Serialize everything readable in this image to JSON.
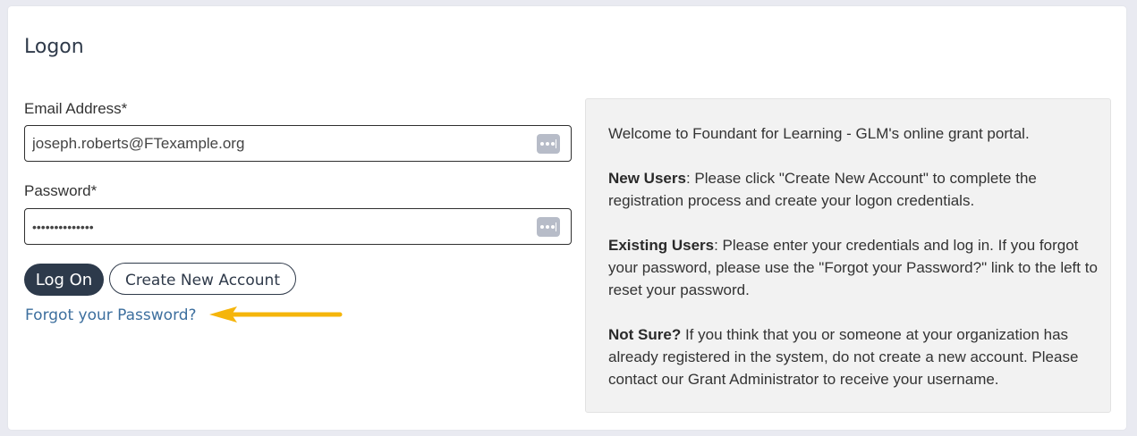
{
  "logon": {
    "title": "Logon",
    "email_label": "Email Address*",
    "email_value": "joseph.roberts@FTexample.org",
    "password_label": "Password*",
    "password_value": "••••••••••••••",
    "login_button": "Log On",
    "create_account_button": "Create New Account",
    "forgot_link": "Forgot your Password?"
  },
  "info": {
    "welcome": "Welcome to Foundant for Learning - GLM's online grant portal.",
    "new_users_title": "New Users",
    "new_users_text": ": Please click \"Create New Account\" to complete the registration process and create your logon credentials.",
    "existing_users_title": "Existing Users",
    "existing_users_text": ": Please enter your credentials and log in. If you forgot your password, please use the \"Forgot your Password?\" link to the left to reset your password.",
    "not_sure_title": "Not Sure?",
    "not_sure_text": " If you think that you or someone at your organization has already registered in the system, do not create a new account. Please contact our Grant Administrator to receive your username."
  },
  "icons": {
    "password_manager": "password-manager-icon",
    "annotation_arrow": "annotation-arrow"
  },
  "colors": {
    "primary_button": "#2d3a4b",
    "link": "#3d6f9e",
    "arrow": "#f5b50a",
    "info_background": "#f2f2f2"
  }
}
